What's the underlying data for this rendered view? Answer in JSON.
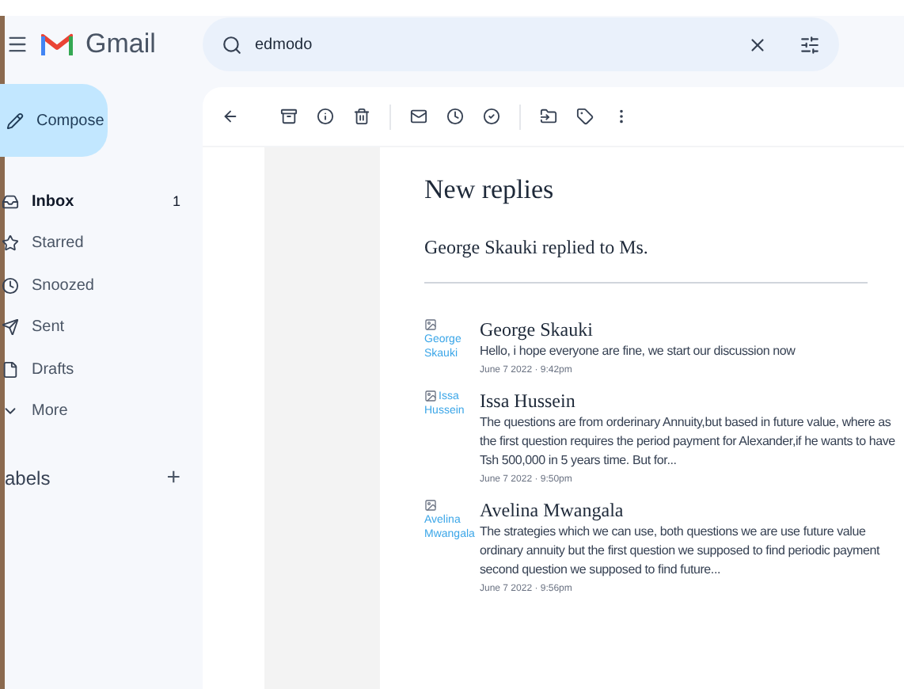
{
  "app": {
    "name": "Gmail"
  },
  "search": {
    "value": "edmodo"
  },
  "compose": {
    "label": "Compose"
  },
  "sidebar": {
    "items": [
      {
        "label": "Inbox",
        "count": "1",
        "selected": true,
        "kind": "inbox"
      },
      {
        "label": "Starred",
        "selected": false,
        "kind": "starred"
      },
      {
        "label": "Snoozed",
        "selected": false,
        "kind": "snoozed"
      },
      {
        "label": "Sent",
        "selected": false,
        "kind": "sent"
      },
      {
        "label": "Drafts",
        "selected": false,
        "kind": "drafts"
      },
      {
        "label": "More",
        "selected": false,
        "kind": "more"
      }
    ],
    "labels_heading": "abels",
    "add": "+"
  },
  "email": {
    "title": "New replies",
    "subtitle": "George Skauki replied to Ms.",
    "messages": [
      {
        "alt": "George Skauki",
        "name": "George Skauki",
        "body": "Hello, i hope everyone are fine, we start our discussion now",
        "date": "June 7 2022 · 9:42pm"
      },
      {
        "alt": "Issa Hussein",
        "name": "Issa Hussein",
        "body": "The questions are from orderinary Annuity,but based in future value, where as the first question requires the period payment for Alexander,if he wants to have Tsh 500,000 in 5 years time. But for...",
        "date": "June 7 2022 · 9:50pm"
      },
      {
        "alt": "Avelina Mwangala",
        "name": "Avelina Mwangala",
        "body": "The strategies which we can use, both questions we are use future value ordinary annuity but the first question we supposed to find periodic payment second question we supposed to find future...",
        "date": "June 7 2022 · 9:56pm"
      }
    ]
  }
}
